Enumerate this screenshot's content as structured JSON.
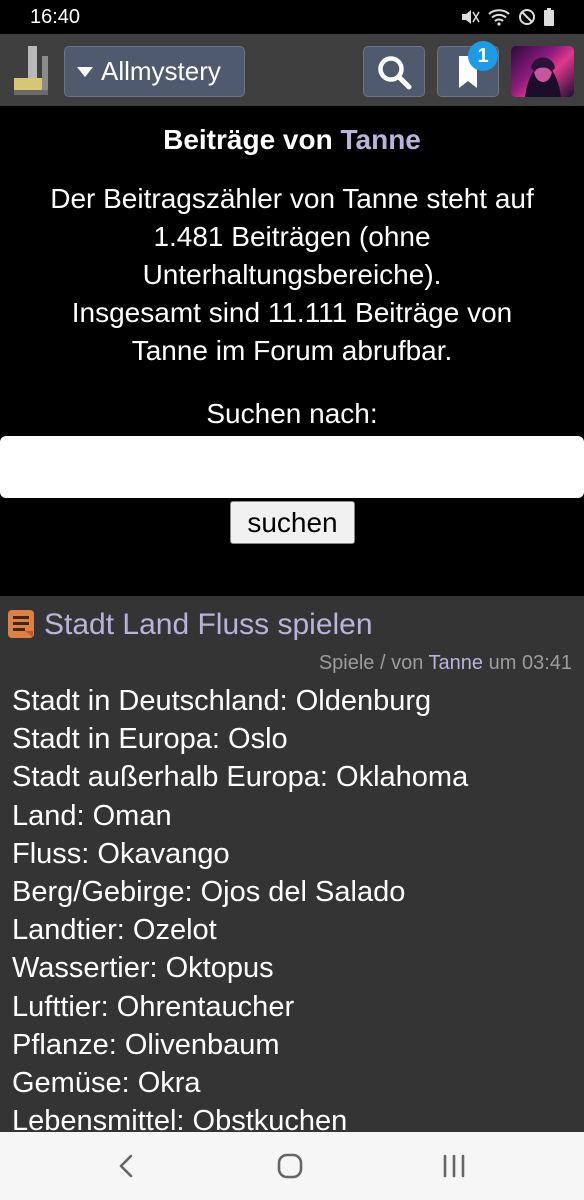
{
  "status": {
    "time": "16:40"
  },
  "header": {
    "forum_label": "Allmystery",
    "notification_count": "1"
  },
  "profile": {
    "title_prefix": "Beiträge von",
    "username": "Tanne",
    "description_lines": [
      "Der Beitragszähler von Tanne steht auf",
      "1.481 Beiträgen (ohne",
      "Unterhaltungsbereiche).",
      "Insgesamt sind 11.111 Beiträge von",
      "Tanne im Forum abrufbar."
    ],
    "search_label": "Suchen nach:",
    "search_value": "",
    "search_button": "suchen"
  },
  "post": {
    "title": "Stadt Land Fluss spielen",
    "category": "Spiele",
    "by_label": "/ von",
    "user": "Tanne",
    "time_label": "um 03:41",
    "lines": [
      "Stadt in Deutschland: Oldenburg",
      "Stadt in Europa: Oslo",
      "Stadt außerhalb Europa: Oklahoma",
      "Land: Oman",
      "Fluss: Okavango",
      "Berg/Gebirge: Ojos del Salado",
      "Landtier: Ozelot",
      "Wassertier: Oktopus",
      "Lufttier: Ohrentaucher",
      "Pflanze: Olivenbaum",
      "Gemüse: Okra",
      "Lebensmittel: Obstkuchen"
    ]
  },
  "icons": {
    "logo": "allmystery-logo-icon",
    "search": "search-icon",
    "bookmark": "bookmark-icon",
    "post": "post-icon",
    "back": "back-icon",
    "home": "home-icon",
    "recent": "recent-apps-icon"
  },
  "colors": {
    "header_bg": "#3f3f3f",
    "button_bg": "#505a6e",
    "badge": "#1e9be6",
    "username": "#b8b4dc",
    "post_bg": "#343434",
    "meta": "#9c9c9c"
  }
}
